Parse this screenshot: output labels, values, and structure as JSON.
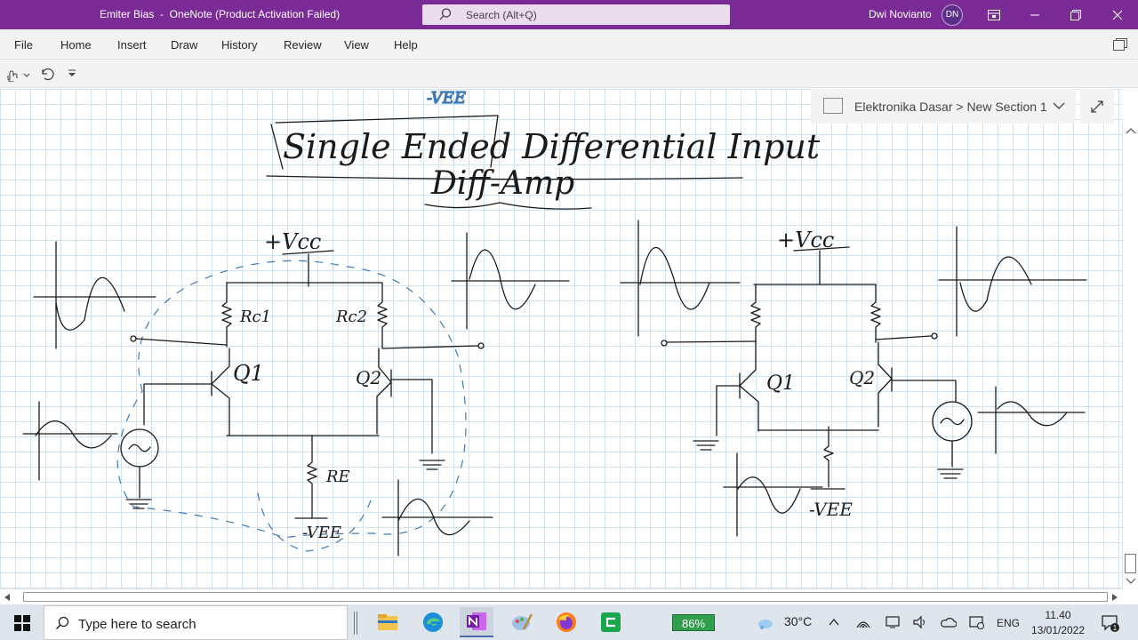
{
  "window": {
    "title": "Emiter Bias  -  OneNote (Product Activation Failed)",
    "search_placeholder": "Search (Alt+Q)",
    "user_name": "Dwi Novianto",
    "user_initials": "DN",
    "accent_color": "#7a2b96"
  },
  "menu": {
    "items": [
      "File",
      "Home",
      "Insert",
      "Draw",
      "History",
      "Review",
      "View",
      "Help"
    ]
  },
  "quick_access": {
    "icons": [
      "touch-mode-icon",
      "undo-icon",
      "customize-icon"
    ]
  },
  "notebook": {
    "breadcrumb": "Elektronika Dasar > New Section 1"
  },
  "page": {
    "note_title_line1": "Single Ended Differential Input",
    "note_title_line2": "Diff-Amp",
    "top_fragment": "-VEE",
    "left_circuit": {
      "vcc": "+Vcc",
      "rc1": "Rc1",
      "rc2": "Rc2",
      "q1": "Q1",
      "q2": "Q2",
      "re": "RE",
      "vee": "-VEE"
    },
    "right_circuit": {
      "vcc": "+Vcc",
      "q1": "Q1",
      "q2": "Q2",
      "vee": "-VEE"
    }
  },
  "taskbar": {
    "search_placeholder": "Type here to search",
    "apps": [
      "file-explorer-icon",
      "edge-icon",
      "onenote-icon",
      "paint-icon",
      "firefox-icon",
      "camtasia-icon"
    ],
    "battery": "86%",
    "temperature": "30°C",
    "language": "ENG",
    "time": "11.40",
    "date": "13/01/2022",
    "notifications": "1"
  }
}
